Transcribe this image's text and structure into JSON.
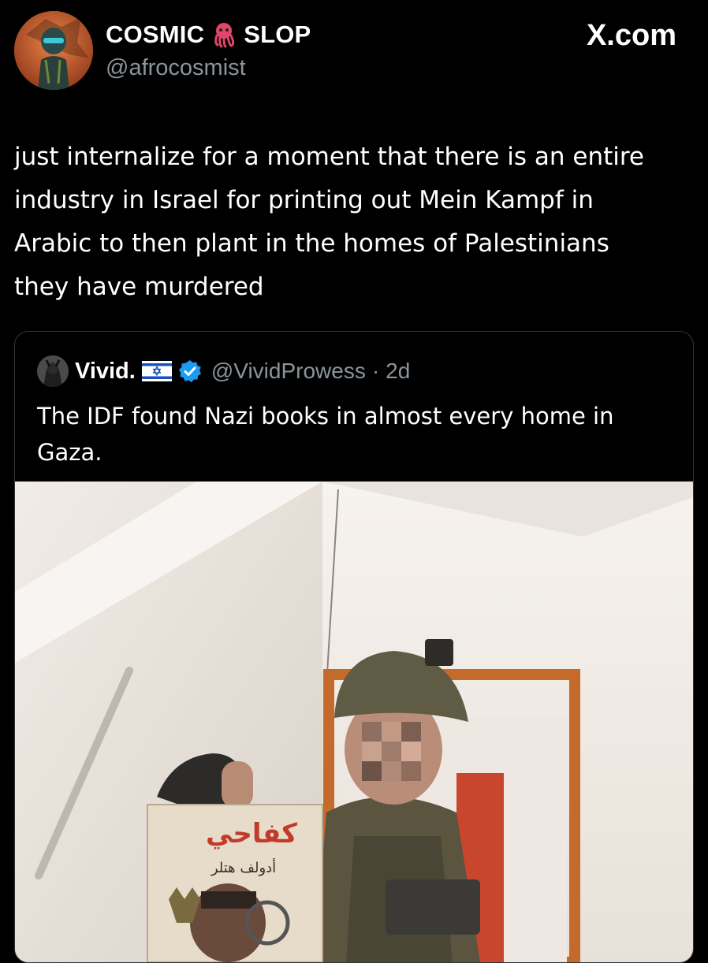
{
  "author": {
    "display_name_left": "COSMIC",
    "display_name_emoji": "🐙",
    "display_name_right": "SLOP",
    "handle": "@afrocosmist"
  },
  "brand": {
    "site": "X.com"
  },
  "tweet": {
    "text": "just internalize for a moment that there is an entire\nindustry in Israel for printing out Mein Kampf in\nArabic to then plant in the homes of Palestinians\nthey have murdered"
  },
  "quoted": {
    "display_name": "Vivid.",
    "handle": "@VividProwess",
    "separator": "·",
    "time": "2d",
    "text": "The IDF found Nazi books in almost every home in Gaza.",
    "verified_icon": "verified-badge-icon",
    "flag_icon": "israel-flag-icon"
  },
  "media": {
    "book_title_arabic": "كفاحي",
    "book_author_arabic": "أدولف هتلر"
  },
  "colors": {
    "background": "#000000",
    "text": "#ffffff",
    "secondary_text": "#8b949a",
    "border": "#333639",
    "verified": "#1d9bf0"
  }
}
